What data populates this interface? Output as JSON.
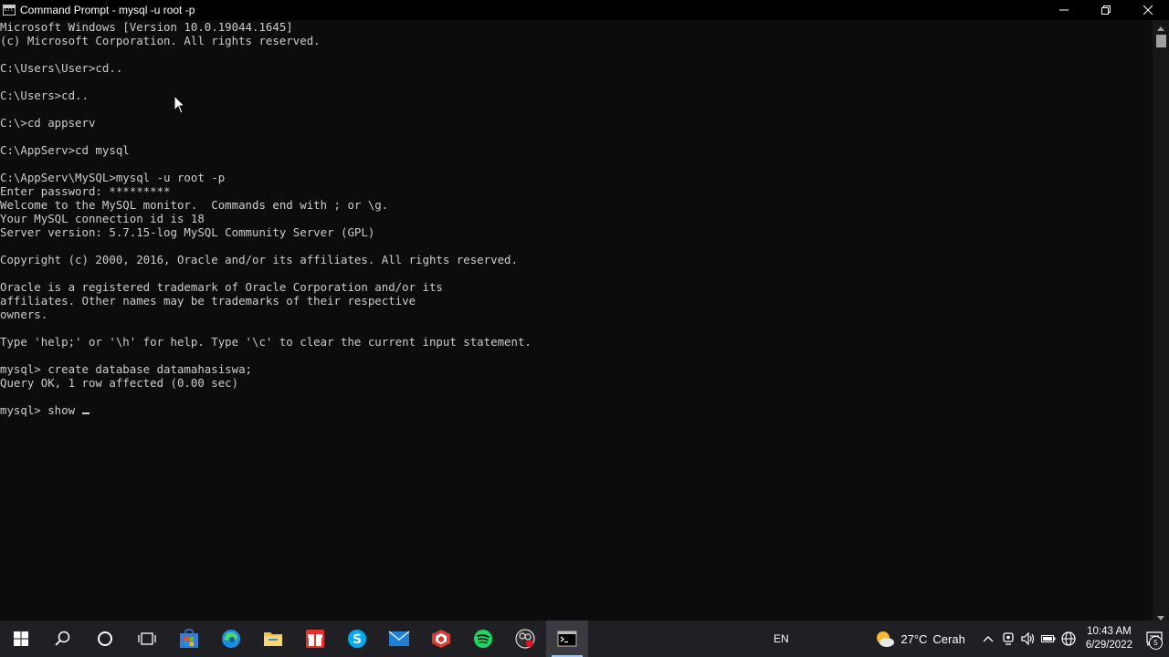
{
  "window": {
    "title": "Command Prompt - mysql  -u root -p"
  },
  "terminal": {
    "lines": [
      "Microsoft Windows [Version 10.0.19044.1645]",
      "(c) Microsoft Corporation. All rights reserved.",
      "",
      "C:\\Users\\User>cd..",
      "",
      "C:\\Users>cd..",
      "",
      "C:\\>cd appserv",
      "",
      "C:\\AppServ>cd mysql",
      "",
      "C:\\AppServ\\MySQL>mysql -u root -p",
      "Enter password: *********",
      "Welcome to the MySQL monitor.  Commands end with ; or \\g.",
      "Your MySQL connection id is 18",
      "Server version: 5.7.15-log MySQL Community Server (GPL)",
      "",
      "Copyright (c) 2000, 2016, Oracle and/or its affiliates. All rights reserved.",
      "",
      "Oracle is a registered trademark of Oracle Corporation and/or its",
      "affiliates. Other names may be trademarks of their respective",
      "owners.",
      "",
      "Type 'help;' or '\\h' for help. Type '\\c' to clear the current input statement.",
      "",
      "mysql> create database datamahasiswa;",
      "Query OK, 1 row affected (0.00 sec)",
      ""
    ],
    "current_input": "mysql> show "
  },
  "taskbar": {
    "apps": [
      {
        "name": "windows-start-icon"
      },
      {
        "name": "search-icon"
      },
      {
        "name": "cortana-icon"
      },
      {
        "name": "task-view-icon"
      },
      {
        "name": "microsoft-store-icon"
      },
      {
        "name": "edge-icon"
      },
      {
        "name": "file-explorer-icon"
      },
      {
        "name": "gift-app-icon"
      },
      {
        "name": "skype-icon"
      },
      {
        "name": "mail-icon"
      },
      {
        "name": "sketchup-icon"
      },
      {
        "name": "spotify-icon"
      },
      {
        "name": "obs-icon"
      },
      {
        "name": "command-prompt-icon"
      }
    ],
    "language": "EN",
    "weather": {
      "temp": "27°C",
      "condition": "Cerah"
    },
    "clock": {
      "time": "10:43 AM",
      "date": "6/29/2022"
    },
    "notification_count": "5"
  },
  "colors": {
    "terminal_bg": "#0c0c0c",
    "terminal_fg": "#cccccc",
    "taskbar_bg": "#1f1f24",
    "title_bg": "#000000"
  }
}
